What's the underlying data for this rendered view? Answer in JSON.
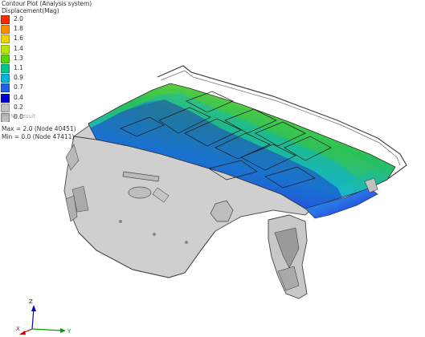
{
  "legend": {
    "title": "Contour Plot (Analysis system)",
    "subtitle": "Displacement(Mag)",
    "levels": [
      {
        "value": "2.0",
        "color": "#ff2a00"
      },
      {
        "value": "1.8",
        "color": "#ff8c00"
      },
      {
        "value": "1.6",
        "color": "#f0d000"
      },
      {
        "value": "1.4",
        "color": "#b9e800"
      },
      {
        "value": "1.3",
        "color": "#55d800"
      },
      {
        "value": "1.1",
        "color": "#00c88a"
      },
      {
        "value": "0.9",
        "color": "#00b4e0"
      },
      {
        "value": "0.7",
        "color": "#2060e8"
      },
      {
        "value": "0.4",
        "color": "#0000cc"
      },
      {
        "value": "0.2",
        "color": "#c0c0c0"
      },
      {
        "value": "0.0",
        "color": "#b0b0b0"
      }
    ],
    "no_result_label": "No result",
    "max_text": "Max = 2.0 (Node 40451)",
    "min_text": "Min = 0.0 (Node 47411)"
  },
  "triad": {
    "x_label": "X",
    "y_label": "Y",
    "z_label": "Z",
    "x_color": "#d00000",
    "y_color": "#00a000",
    "z_color": "#0000c0"
  },
  "model": {
    "name_icon": "trunk-lid-contour-icon"
  }
}
